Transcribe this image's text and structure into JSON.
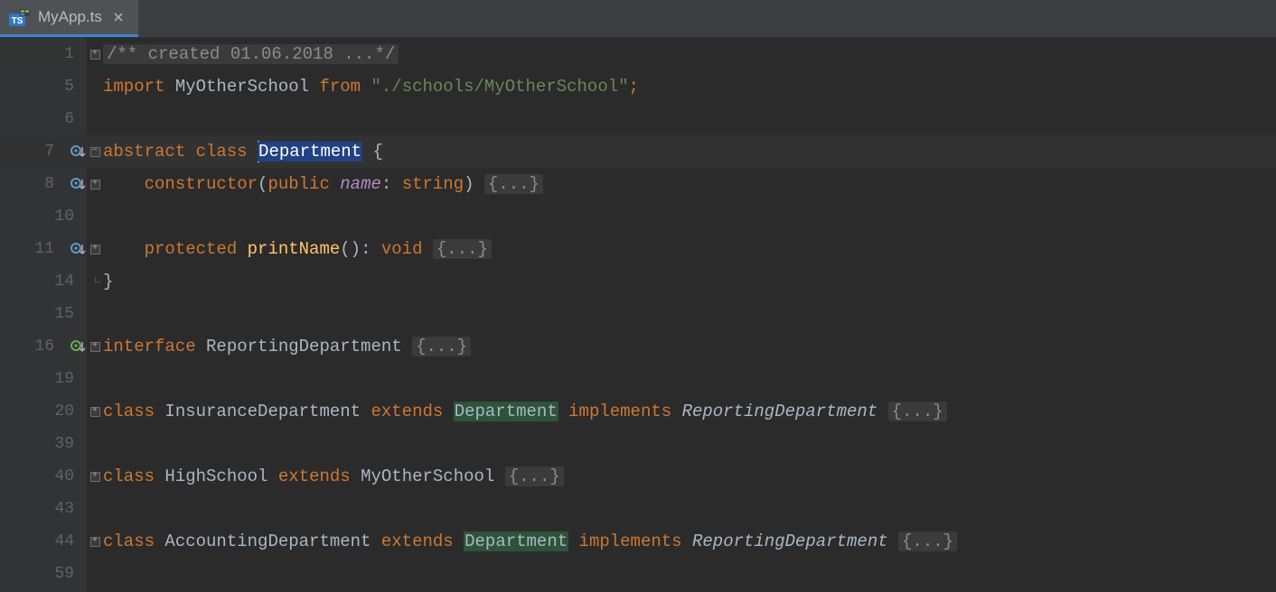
{
  "tab": {
    "filename": "MyApp.ts"
  },
  "gutter": {
    "lines": [
      "1",
      "5",
      "6",
      "7",
      "8",
      "10",
      "11",
      "14",
      "15",
      "16",
      "19",
      "20",
      "39",
      "40",
      "43",
      "44",
      "59"
    ],
    "icons": {
      "7": "override-blue",
      "8": "override-blue",
      "11": "override-blue",
      "16": "implement-green"
    }
  },
  "fold": {
    "plus": "+",
    "minus": "−"
  },
  "code": {
    "l1": {
      "doc": "/** created 01.06.2018 ...*/"
    },
    "l5": {
      "import": "import",
      "ident": "MyOtherSchool",
      "from": "from",
      "path": "\"./schools/MyOtherSchool\"",
      "semi": ";"
    },
    "l7": {
      "abstract": "abstract",
      "class": "class",
      "name": "Department",
      "brace": "{"
    },
    "l8": {
      "constructor": "constructor",
      "open": "(",
      "public": "public",
      "param": "name",
      "colon": ": ",
      "type": "string",
      "close": ") "
    },
    "l11": {
      "protected": "protected",
      "name": "printName",
      "sig": "(): ",
      "void": "void"
    },
    "l14": {
      "brace": "}"
    },
    "l16": {
      "interface": "interface",
      "name": "ReportingDepartment"
    },
    "l20": {
      "class": "class",
      "name": "InsuranceDepartment",
      "extends": "extends",
      "base": "Department",
      "implements": "implements",
      "iface": "ReportingDepartment"
    },
    "l40": {
      "class": "class",
      "name": "HighSchool",
      "extends": "extends",
      "base": "MyOtherSchool"
    },
    "l44": {
      "class": "class",
      "name": "AccountingDepartment",
      "extends": "extends",
      "base": "Department",
      "implements": "implements",
      "iface": "ReportingDepartment"
    },
    "foldedBody": "{...}",
    "space": " "
  }
}
